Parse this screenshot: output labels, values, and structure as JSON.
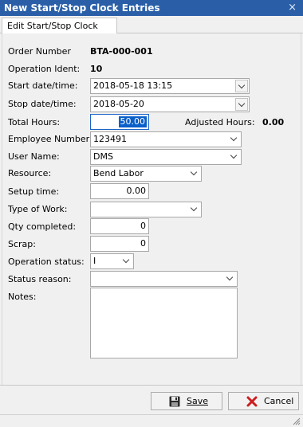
{
  "window": {
    "title": "New Start/Stop Clock Entries",
    "close_glyph": "×"
  },
  "tabs": [
    {
      "label": "Edit Start/Stop Clock Entry"
    }
  ],
  "form": {
    "order_number": {
      "label": "Order Number",
      "value": "BTA-000-001"
    },
    "operation_ident": {
      "label": "Operation Ident:",
      "value": "10"
    },
    "start_datetime": {
      "label": "Start date/time:",
      "value": "2018-05-18 13:15"
    },
    "stop_datetime": {
      "label": "Stop date/time:",
      "value": "2018-05-20"
    },
    "total_hours": {
      "label": "Total Hours:",
      "value": "50.00"
    },
    "adjusted_hours": {
      "label": "Adjusted Hours:",
      "value": "0.00"
    },
    "employee_number": {
      "label": "Employee Number:",
      "value": "123491"
    },
    "user_name": {
      "label": "User Name:",
      "value": "DMS"
    },
    "resource": {
      "label": "Resource:",
      "value": "Bend Labor"
    },
    "setup_time": {
      "label": "Setup time:",
      "value": "0.00"
    },
    "type_of_work": {
      "label": "Type of Work:",
      "value": ""
    },
    "qty_completed": {
      "label": "Qty completed:",
      "value": "0"
    },
    "scrap": {
      "label": "Scrap:",
      "value": "0"
    },
    "operation_status": {
      "label": "Operation status:",
      "value": "I"
    },
    "status_reason": {
      "label": "Status reason:",
      "value": ""
    },
    "notes": {
      "label": "Notes:",
      "value": ""
    }
  },
  "buttons": {
    "save": {
      "label": "Save",
      "icon": "floppy-disk-icon"
    },
    "cancel": {
      "label": "Cancel",
      "icon": "red-x-icon",
      "icon_color": "#cc1f1f"
    }
  },
  "colors": {
    "titlebar": "#2a5fa8",
    "selection": "#0a5fc9"
  }
}
